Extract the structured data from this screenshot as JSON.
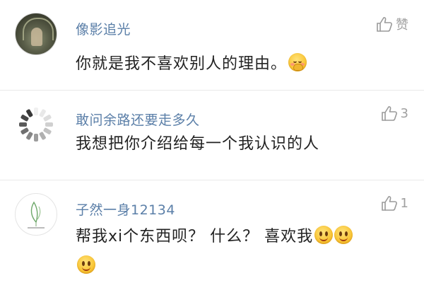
{
  "comments": [
    {
      "username": "像影追光",
      "text": "你就是我不喜欢别人的理由。",
      "emoji": [
        "shy-smile-emoji"
      ],
      "like_label": "赞",
      "like_count": ""
    },
    {
      "username": "敢问余路还要走多久",
      "text": "我想把你介绍给每一个我认识的人",
      "emoji": [],
      "like_label": "",
      "like_count": "3"
    },
    {
      "username": "子然一身12134",
      "text": "帮我xi个东西呗？ 什么？ 喜欢我",
      "emoji": [
        "smile-emoji",
        "smile-emoji",
        "smile-emoji"
      ],
      "like_label": "",
      "like_count": "1"
    }
  ],
  "icons": {
    "like": "thumbs-up-icon",
    "loading_avatar": "spinner-icon",
    "leaf_avatar": "leaf-logo-avatar"
  },
  "colors": {
    "username": "#5b7fa8",
    "body_text": "#222222",
    "like": "#a0a0a0",
    "divider": "#e9e9e9"
  }
}
